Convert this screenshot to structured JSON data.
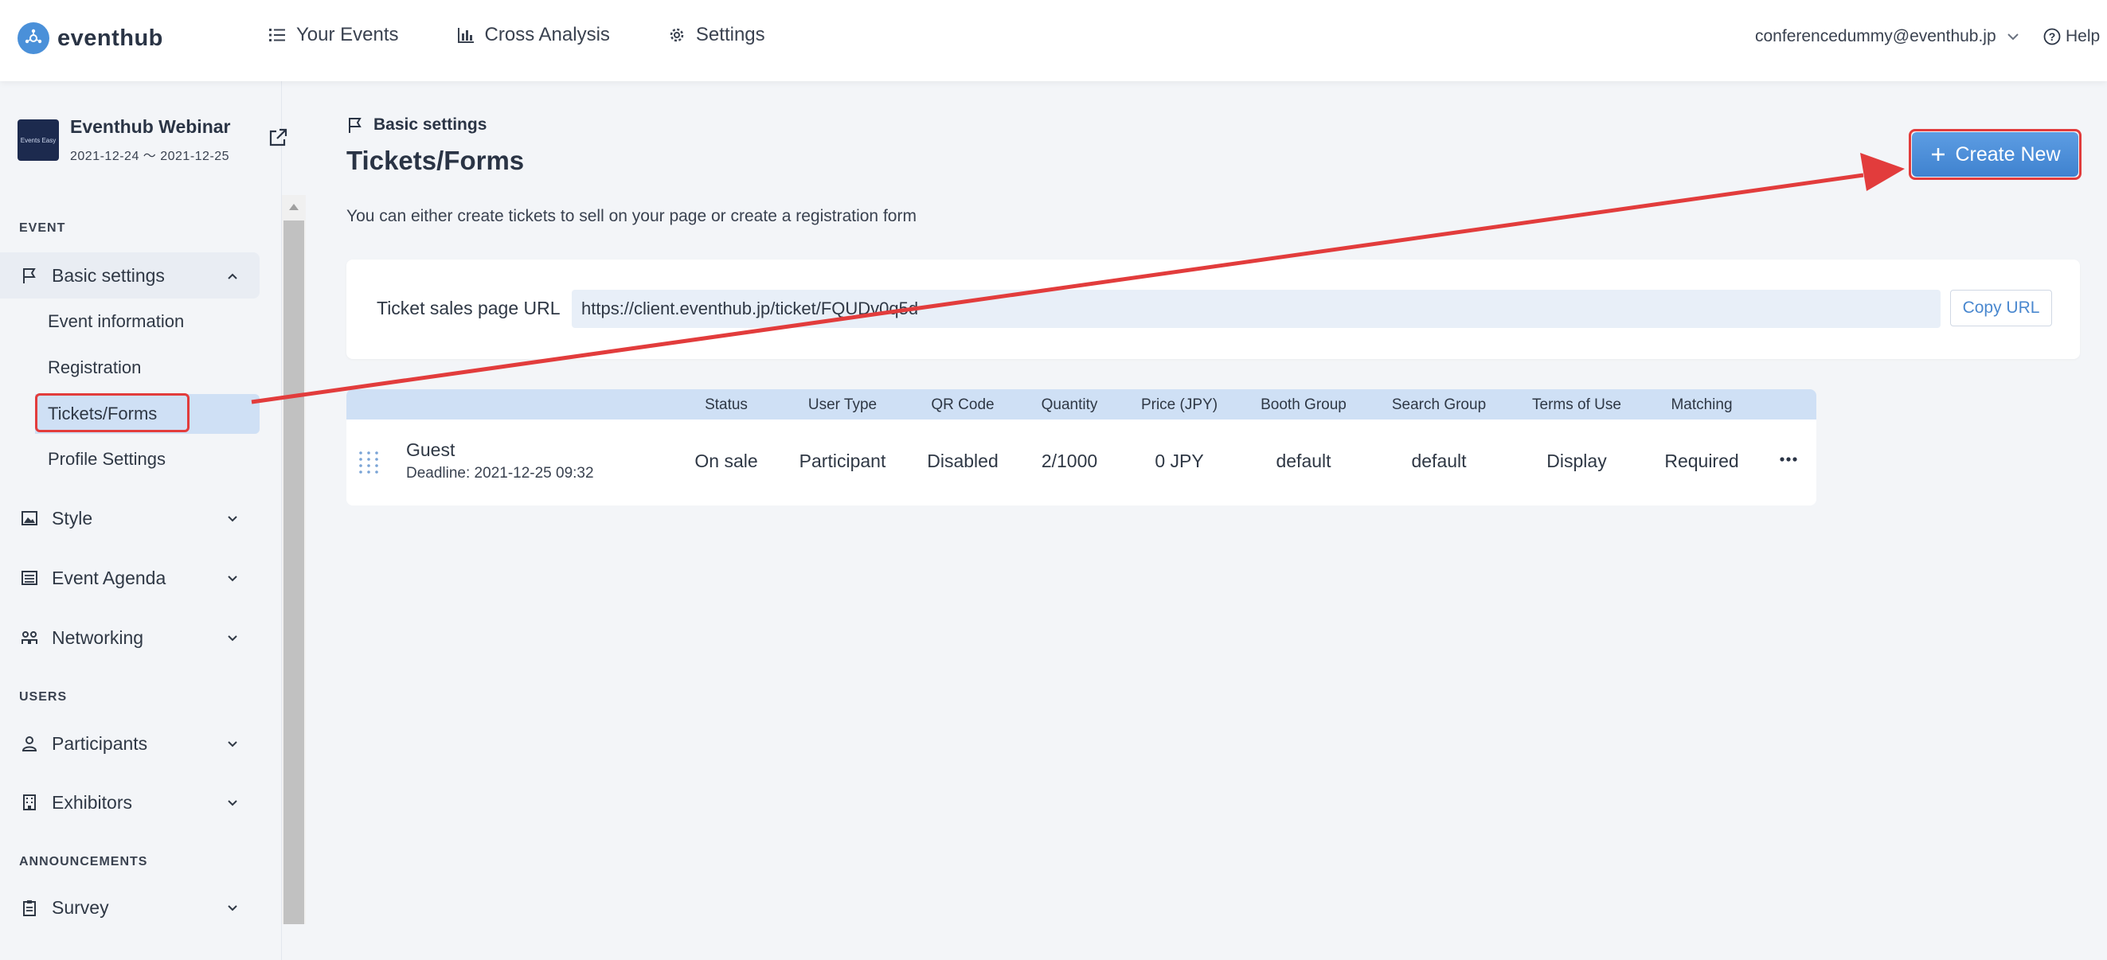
{
  "header": {
    "brand": "eventhub",
    "nav": [
      {
        "label": "Your Events",
        "icon": "list-icon"
      },
      {
        "label": "Cross Analysis",
        "icon": "bar-chart-icon"
      },
      {
        "label": "Settings",
        "icon": "gear-icon"
      }
    ],
    "user_email": "conferencedummy@eventhub.jp",
    "help": "Help"
  },
  "sidebar": {
    "event": {
      "thumb_text": "Events Easy",
      "title": "Eventhub Webinar",
      "dates": "2021-12-24 ～ 2021-12-25"
    },
    "sections": {
      "event": "EVENT",
      "users": "USERS",
      "announcements": "ANNOUNCEMENTS"
    },
    "basic_settings": "Basic settings",
    "sub_items": [
      "Event information",
      "Registration",
      "Tickets/Forms",
      "Profile Settings"
    ],
    "items": {
      "style": "Style",
      "agenda": "Event Agenda",
      "networking": "Networking",
      "participants": "Participants",
      "exhibitors": "Exhibitors",
      "survey": "Survey"
    }
  },
  "main": {
    "breadcrumb": "Basic settings",
    "title": "Tickets/Forms",
    "subtitle": "You can either create tickets to sell on your page or create a registration form",
    "create_button": "Create New",
    "url_label": "Ticket sales page URL",
    "url_value": "https://client.eventhub.jp/ticket/FQUDv0q5d",
    "copy_button": "Copy URL",
    "table": {
      "headers": [
        "Status",
        "User Type",
        "QR Code",
        "Quantity",
        "Price (JPY)",
        "Booth Group",
        "Search Group",
        "Terms of Use",
        "Matching"
      ],
      "rows": [
        {
          "name": "Guest",
          "deadline": "Deadline: 2021-12-25 09:32",
          "cells": [
            "On sale",
            "Participant",
            "Disabled",
            "2/1000",
            "0 JPY",
            "default",
            "default",
            "Display",
            "Required"
          ]
        }
      ]
    }
  },
  "colors": {
    "accent": "#4a88cf",
    "annotation": "#e23c3c",
    "active_bg": "#cfe0f5"
  }
}
